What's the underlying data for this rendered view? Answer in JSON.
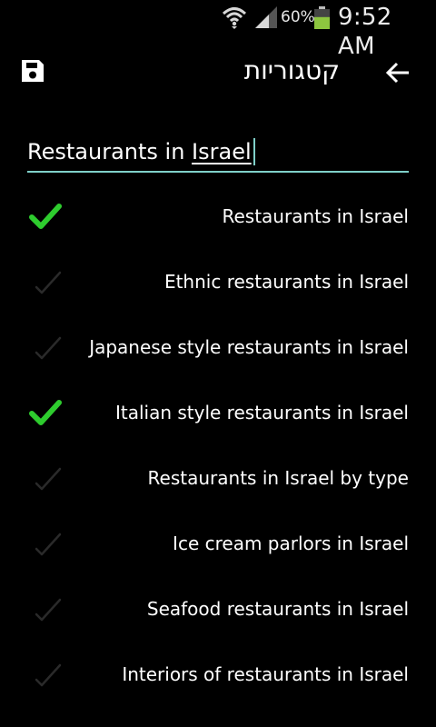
{
  "status_bar": {
    "battery_percent": "60%",
    "time": "9:52 AM",
    "wifi_icon": "wifi-icon",
    "signal_icon": "signal-icon",
    "battery_icon": "battery-icon",
    "battery_level": 0.6
  },
  "action_bar": {
    "title": "קטגוריות",
    "save_icon": "save-icon",
    "back_icon": "arrow-back-icon"
  },
  "search": {
    "value": "Restaurants in Israel",
    "value_prefix": "Restaurants in ",
    "value_underlined": "Israel"
  },
  "categories": {
    "items": [
      {
        "label": "Restaurants in Israel",
        "checked": true
      },
      {
        "label": "Ethnic restaurants in Israel",
        "checked": false
      },
      {
        "label": "Japanese style restaurants in Israel",
        "checked": false
      },
      {
        "label": "Italian style restaurants in Israel",
        "checked": true
      },
      {
        "label": "Restaurants in Israel by type",
        "checked": false
      },
      {
        "label": "Ice cream parlors in Israel",
        "checked": false
      },
      {
        "label": "Seafood restaurants in Israel",
        "checked": false
      },
      {
        "label": "Interiors of restaurants in Israel",
        "checked": false
      }
    ]
  },
  "colors": {
    "accent": "#7fd0c9",
    "checked": "#2ecc2e",
    "unchecked": "#2a2a2a",
    "background": "#000000",
    "battery": "#8dc63f"
  }
}
